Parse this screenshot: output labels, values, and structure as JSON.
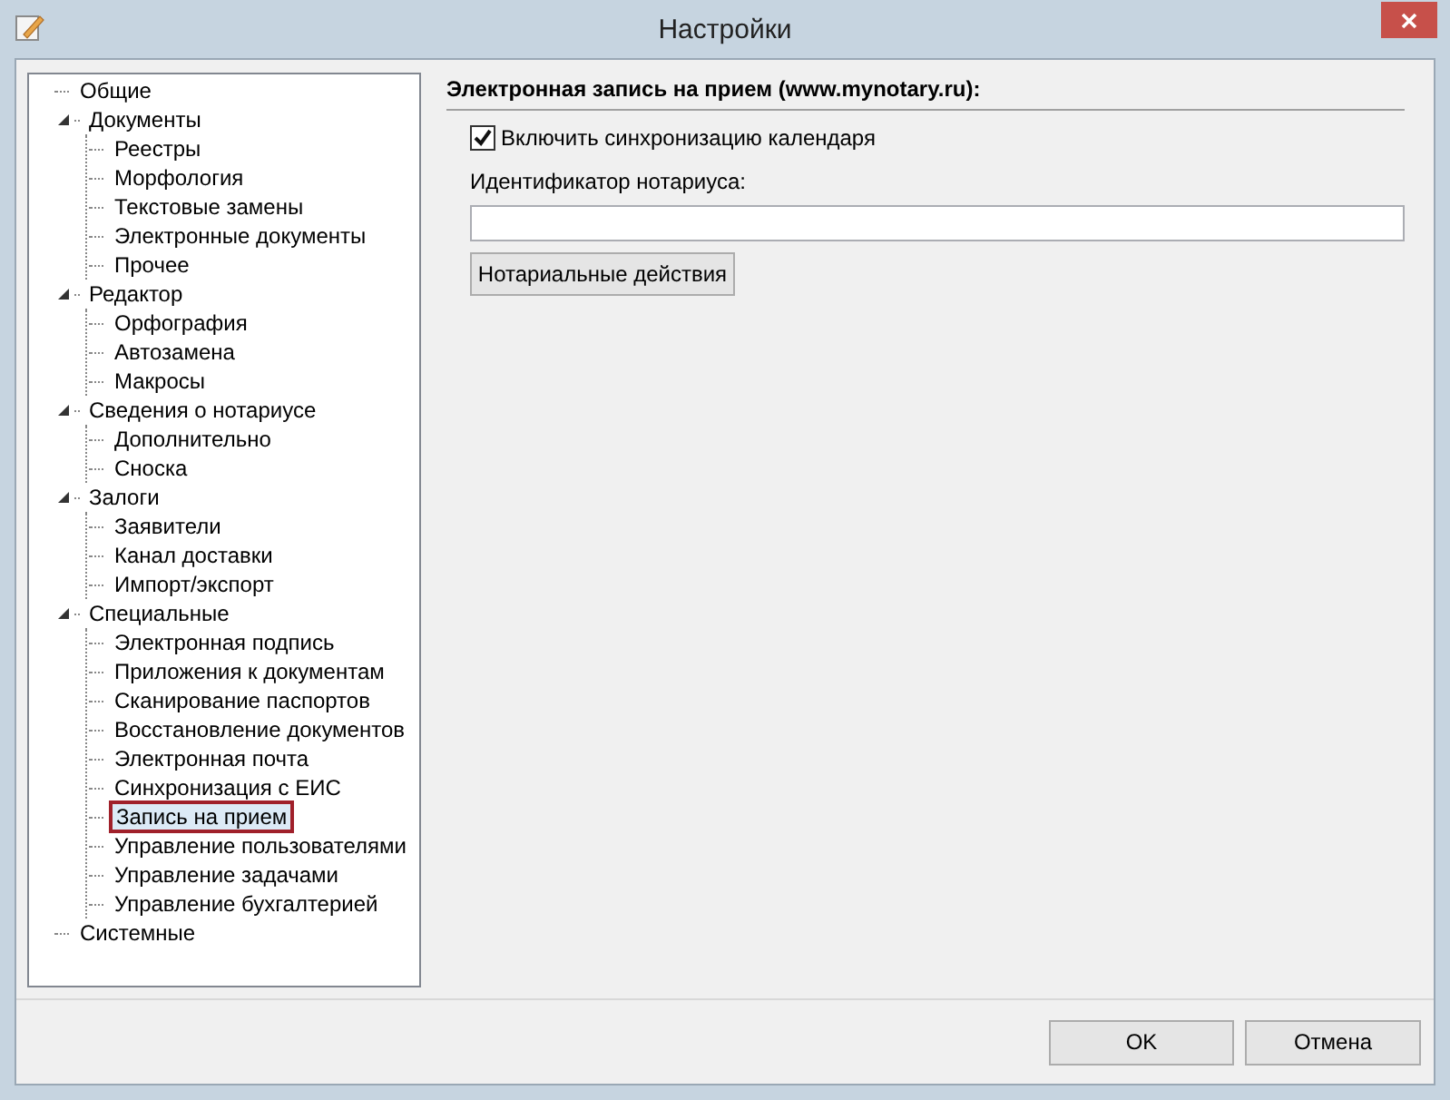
{
  "window": {
    "title": "Настройки"
  },
  "tree": [
    {
      "label": "Общие",
      "selected": false
    },
    {
      "label": "Документы",
      "selected": false,
      "expanded": true,
      "children": [
        {
          "label": "Реестры",
          "selected": false
        },
        {
          "label": "Морфология",
          "selected": false
        },
        {
          "label": "Текстовые замены",
          "selected": false
        },
        {
          "label": "Электронные документы",
          "selected": false
        },
        {
          "label": "Прочее",
          "selected": false
        }
      ]
    },
    {
      "label": "Редактор",
      "selected": false,
      "expanded": true,
      "children": [
        {
          "label": "Орфография",
          "selected": false
        },
        {
          "label": "Автозамена",
          "selected": false
        },
        {
          "label": "Макросы",
          "selected": false
        }
      ]
    },
    {
      "label": "Сведения о нотариусе",
      "selected": false,
      "expanded": true,
      "children": [
        {
          "label": "Дополнительно",
          "selected": false
        },
        {
          "label": "Сноска",
          "selected": false
        }
      ]
    },
    {
      "label": "Залоги",
      "selected": false,
      "expanded": true,
      "children": [
        {
          "label": "Заявители",
          "selected": false
        },
        {
          "label": "Канал доставки",
          "selected": false
        },
        {
          "label": "Импорт/экспорт",
          "selected": false
        }
      ]
    },
    {
      "label": "Специальные",
      "selected": false,
      "expanded": true,
      "children": [
        {
          "label": "Электронная подпись",
          "selected": false
        },
        {
          "label": "Приложения к документам",
          "selected": false
        },
        {
          "label": "Сканирование паспортов",
          "selected": false
        },
        {
          "label": "Восстановление документов",
          "selected": false
        },
        {
          "label": "Электронная почта",
          "selected": false
        },
        {
          "label": "Синхронизация с ЕИС",
          "selected": false
        },
        {
          "label": "Запись на прием",
          "selected": true
        },
        {
          "label": "Управление пользователями",
          "selected": false
        },
        {
          "label": "Управление задачами",
          "selected": false
        },
        {
          "label": "Управление бухгалтерией",
          "selected": false
        }
      ]
    },
    {
      "label": "Системные",
      "selected": false
    }
  ],
  "panel": {
    "heading": "Электронная запись на прием (www.mynotary.ru):",
    "sync_checkbox": {
      "label": "Включить синхронизацию календаря",
      "checked": true
    },
    "notary_id": {
      "label": "Идентификатор нотариуса:"
    },
    "actions_button": "Нотариальные действия"
  },
  "buttons": [
    "OK",
    "Отмена"
  ]
}
